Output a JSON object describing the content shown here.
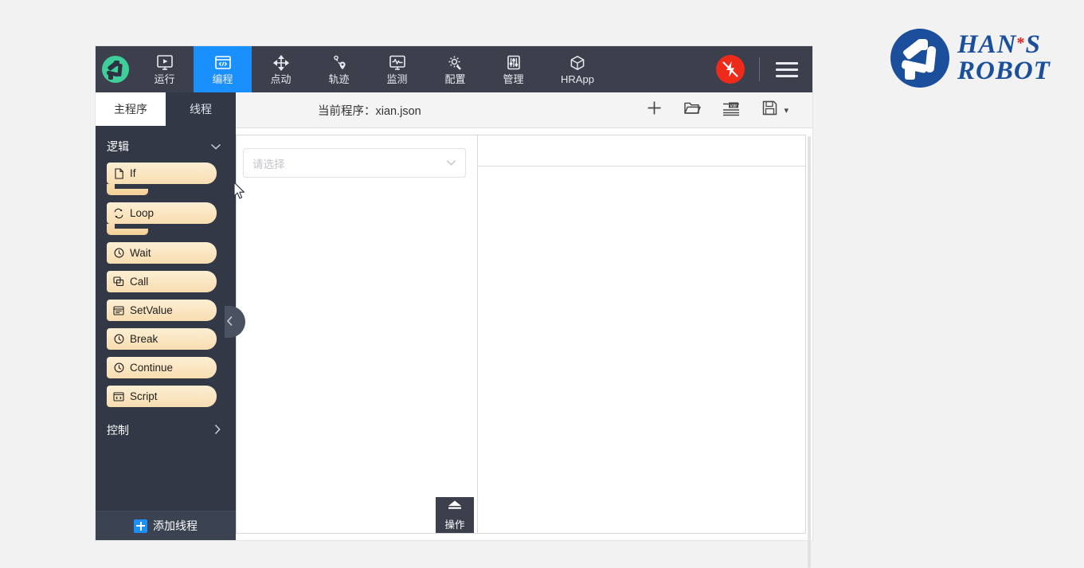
{
  "brand": {
    "line1": "HAN",
    "star": "*",
    "line1b": "S",
    "line2": "ROBOT",
    "color": "#1b4f9c",
    "star_color": "#e02020"
  },
  "toolbar": {
    "app_icon": "robot-arm-icon",
    "active_color": "#1a90ff",
    "items": [
      {
        "label": "运行",
        "icon": "play-monitor-icon",
        "active": false
      },
      {
        "label": "编程",
        "icon": "code-window-icon",
        "active": true
      },
      {
        "label": "点动",
        "icon": "move-arrows-icon",
        "active": false
      },
      {
        "label": "轨迹",
        "icon": "trajectory-icon",
        "active": false
      },
      {
        "label": "监测",
        "icon": "monitor-wave-icon",
        "active": false
      },
      {
        "label": "配置",
        "icon": "gear-wrench-icon",
        "active": false
      },
      {
        "label": "管理",
        "icon": "sliders-icon",
        "active": false
      },
      {
        "label": "HRApp",
        "icon": "cube-icon",
        "active": false
      }
    ],
    "estop": {
      "icon": "power-bolt-off-icon",
      "color": "#ee2b1b"
    },
    "menu": {
      "icon": "hamburger-menu-icon"
    }
  },
  "sidebar": {
    "tabs": [
      {
        "label": "主程序",
        "active": true
      },
      {
        "label": "线程",
        "active": false
      }
    ],
    "categories": [
      {
        "label": "逻辑",
        "expanded": true,
        "chevron": "⌄"
      },
      {
        "label": "控制",
        "expanded": false,
        "chevron": "›"
      }
    ],
    "blocks": [
      {
        "label": "If",
        "icon": "file-icon",
        "shape": "c"
      },
      {
        "label": "Loop",
        "icon": "loop-icon",
        "shape": "c"
      },
      {
        "label": "Wait",
        "icon": "clock-icon",
        "shape": "flat"
      },
      {
        "label": "Call",
        "icon": "copy-icon",
        "shape": "flat"
      },
      {
        "label": "SetValue",
        "icon": "window-icon",
        "shape": "flat"
      },
      {
        "label": "Break",
        "icon": "clock-icon",
        "shape": "flat"
      },
      {
        "label": "Continue",
        "icon": "clock-icon",
        "shape": "flat"
      },
      {
        "label": "Script",
        "icon": "script-icon",
        "shape": "flat"
      }
    ],
    "add_thread": {
      "label": "添加线程",
      "icon": "plus-icon"
    },
    "collapse": {
      "icon": "chevron-left-icon"
    }
  },
  "program": {
    "title": "当前程序：xian.json",
    "actions": [
      {
        "name": "new",
        "icon": "plus-icon"
      },
      {
        "name": "open",
        "icon": "folder-open-icon"
      },
      {
        "name": "variable",
        "icon": "variable-list-icon"
      },
      {
        "name": "save",
        "icon": "floppy-save-icon",
        "caret": "▾"
      }
    ]
  },
  "editor": {
    "select": {
      "placeholder": "请选择",
      "value": "",
      "chevron": "⌄"
    },
    "operation_button": {
      "label": "操作",
      "icon": "eject-icon"
    }
  }
}
